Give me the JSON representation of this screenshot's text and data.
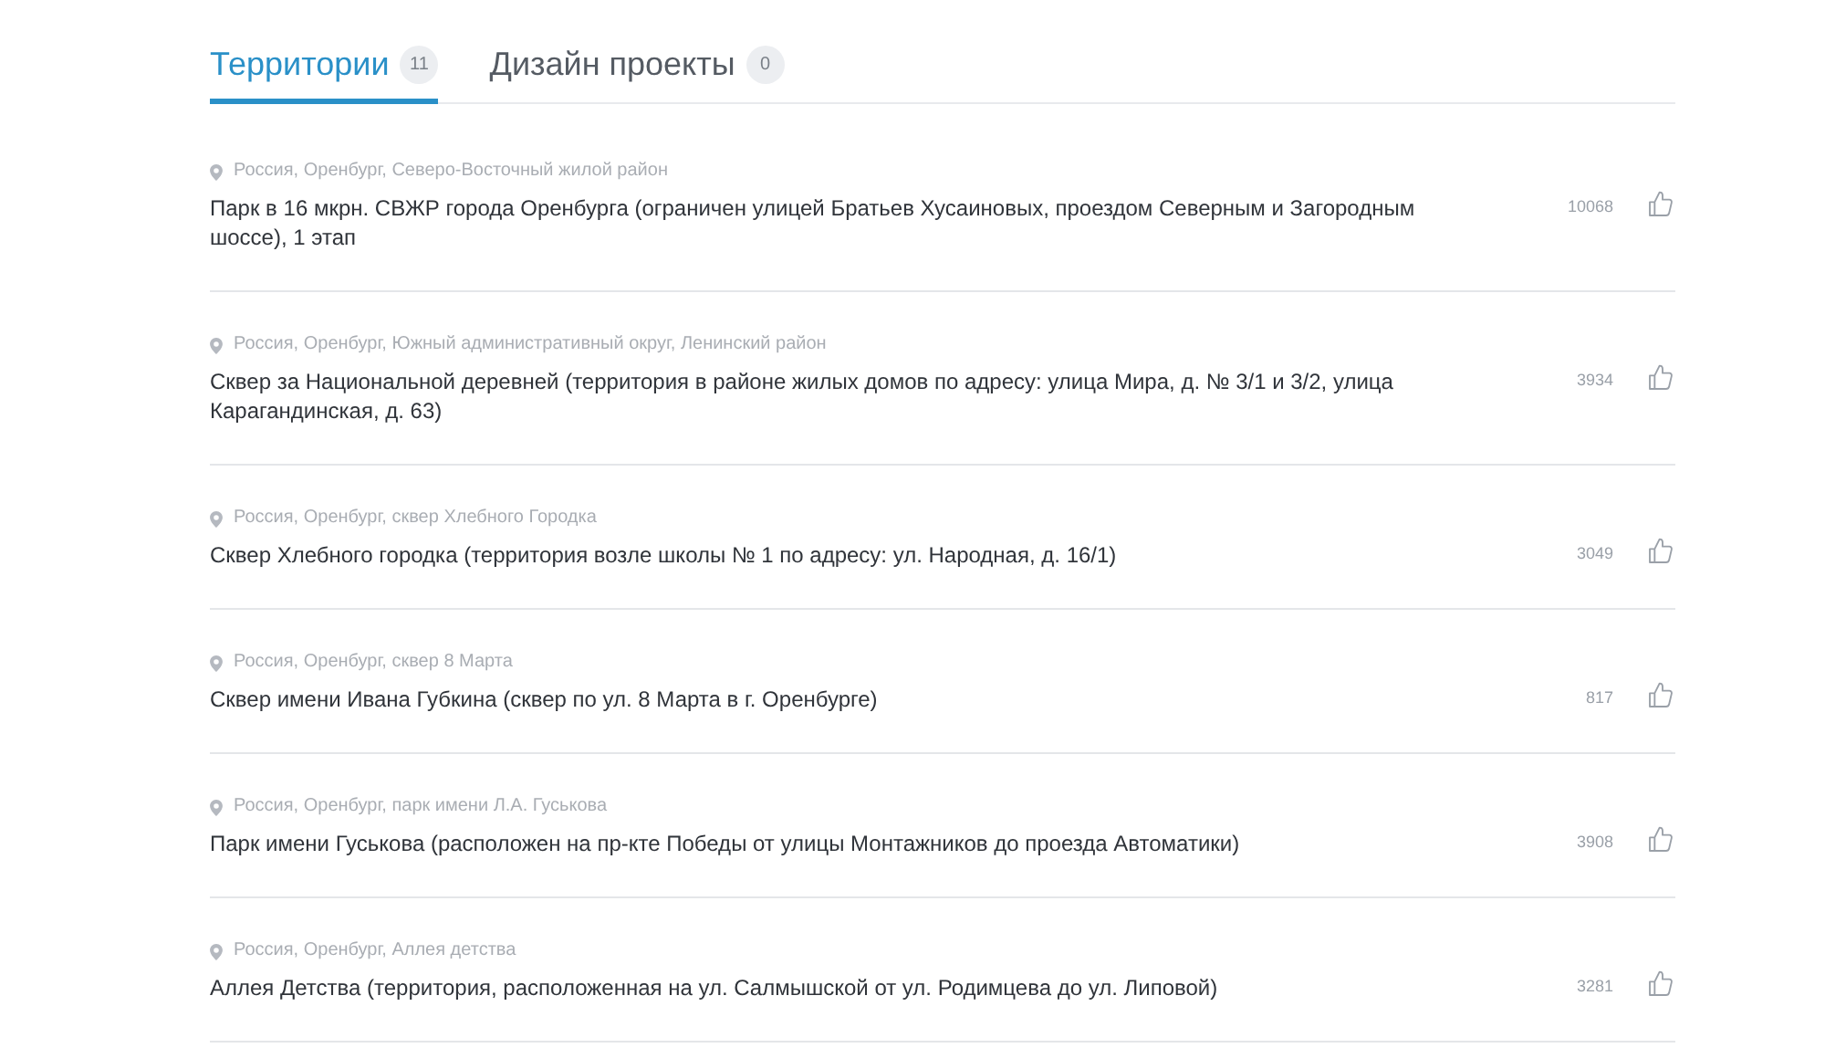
{
  "tabs": [
    {
      "label": "Территории",
      "count": "11",
      "selected": true
    },
    {
      "label": "Дизайн проекты",
      "count": "0",
      "selected": false
    }
  ],
  "items": [
    {
      "location": "Россия, Оренбург, Северо-Восточный жилой район",
      "title": "Парк в 16 мкрн. СВЖР города Оренбурга (ограничен улицей Братьев Хусаиновых, проездом Северным и Загородным шоссе), 1 этап",
      "likes": "10068"
    },
    {
      "location": "Россия, Оренбург, Южный административный округ, Ленинский район",
      "title": "Сквер за Национальной деревней (территория в районе жилых домов по адресу: улица Мира, д. № 3/1 и 3/2, улица Карагандинская, д. 63)",
      "likes": "3934"
    },
    {
      "location": "Россия, Оренбург, сквер Хлебного Городка",
      "title": "Сквер Хлебного городка (территория возле школы № 1 по адресу: ул. Народная, д. 16/1)",
      "likes": "3049"
    },
    {
      "location": "Россия, Оренбург, сквер 8 Марта",
      "title": "Сквер имени Ивана Губкина (сквер по ул. 8 Марта в г. Оренбурге)",
      "likes": "817"
    },
    {
      "location": "Россия, Оренбург, парк имени Л.А. Гуськова",
      "title": "Парк имени Гуськова (расположен на пр-кте Победы от улицы Монтажников до проезда Автоматики)",
      "likes": "3908"
    },
    {
      "location": "Россия, Оренбург, Аллея детства",
      "title": "Аллея Детства (территория, расположенная на ул. Салмышской от ул. Родимцева до ул. Липовой)",
      "likes": "3281"
    }
  ]
}
